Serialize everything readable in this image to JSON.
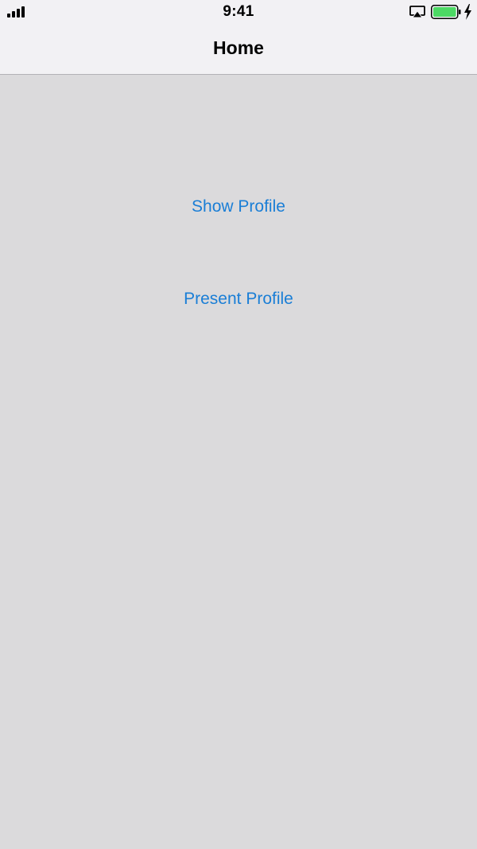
{
  "status_bar": {
    "time": "9:41",
    "signal_icon": "cellular-signal-icon",
    "airplay_icon": "airplay-icon",
    "battery_icon": "battery-icon",
    "charging_icon": "charging-bolt-icon",
    "battery_color": "#4cd964"
  },
  "nav_bar": {
    "title": "Home"
  },
  "content": {
    "show_profile_label": "Show Profile",
    "present_profile_label": "Present Profile",
    "link_color": "#1a7ed6",
    "background_color": "#dbdadc"
  }
}
